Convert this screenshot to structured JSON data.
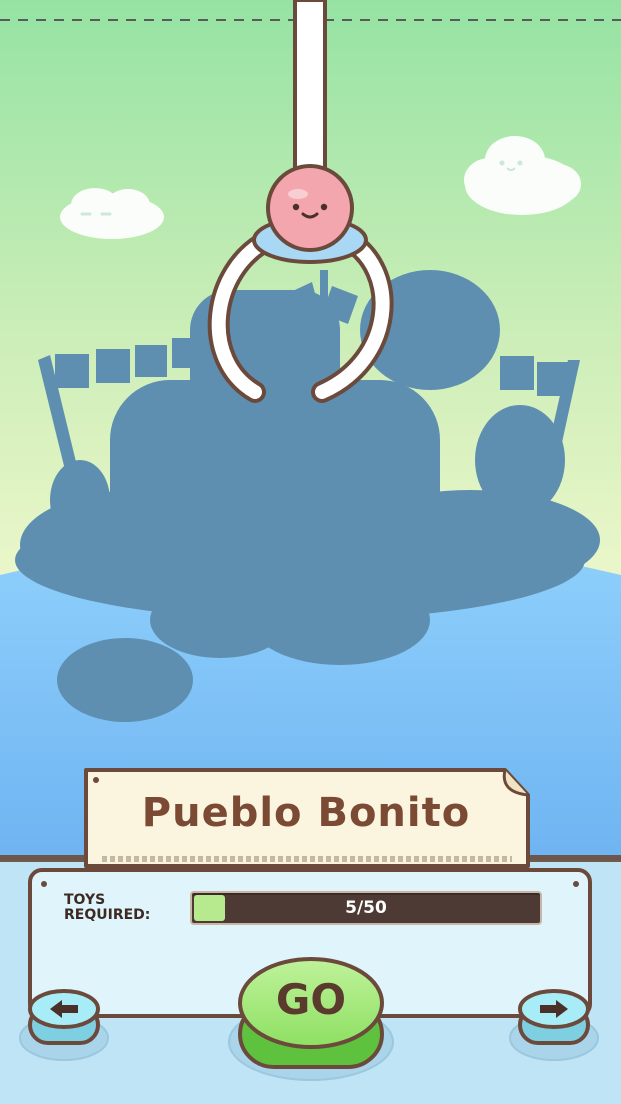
{
  "level": {
    "name": "Pueblo Bonito"
  },
  "toys": {
    "label": "TOYS\nREQUIRED:",
    "collected": 5,
    "required": 50,
    "progress_text": "5/50",
    "progress_fraction": 0.1
  },
  "buttons": {
    "go_label": "GO",
    "prev_icon": "arrow-left-icon",
    "next_icon": "arrow-right-icon"
  },
  "colors": {
    "sky_top": "#9ae3a6",
    "sky_bottom": "#eaf7c9",
    "ground": "#86c6f7",
    "silhouette": "#5f8fb0",
    "panel": "#dff4fb",
    "outline": "#6b4a3b",
    "progress_fill": "#b7ea8e",
    "go_button": "#8bdc5e",
    "arrow_button": "#9fe6f4"
  }
}
